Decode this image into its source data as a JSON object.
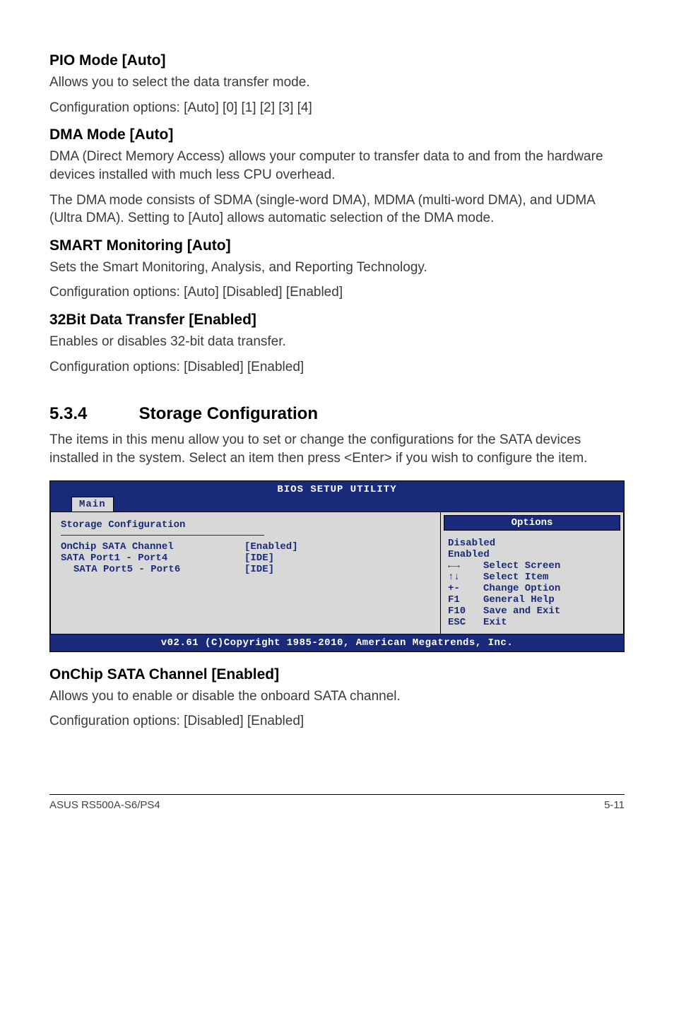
{
  "sections": {
    "pio": {
      "heading": "PIO Mode [Auto]",
      "p1": "Allows you to select the data transfer mode.",
      "p2": "Configuration options: [Auto] [0] [1] [2] [3] [4]"
    },
    "dma": {
      "heading": "DMA Mode [Auto]",
      "p1": "DMA (Direct Memory Access) allows your computer to transfer data to and from the hardware devices installed with much less CPU overhead.",
      "p2": "The DMA mode consists of SDMA (single-word DMA), MDMA (multi-word DMA), and UDMA (Ultra DMA). Setting to [Auto] allows automatic selection of the DMA mode."
    },
    "smart": {
      "heading": "SMART Monitoring [Auto]",
      "p1": "Sets the Smart Monitoring, Analysis, and Reporting Technology.",
      "p2": "Configuration options: [Auto] [Disabled] [Enabled]"
    },
    "bit32": {
      "heading": "32Bit Data Transfer [Enabled]",
      "p1": "Enables or disables 32-bit data transfer.",
      "p2": "Configuration options: [Disabled] [Enabled]"
    },
    "storage": {
      "num": "5.3.4",
      "title": "Storage Configuration",
      "p1": "The items in this menu allow you to set or change the configurations for the SATA devices installed in the system. Select an item then press <Enter> if you wish to configure the item."
    },
    "onchip": {
      "heading": "OnChip SATA Channel [Enabled]",
      "p1": "Allows you to enable or disable the onboard SATA channel.",
      "p2": "Configuration options: [Disabled] [Enabled]"
    }
  },
  "bios": {
    "title": "BIOS SETUP UTILITY",
    "tab": "Main",
    "left_heading": "Storage Configuration",
    "rows": [
      {
        "label": "OnChip SATA Channel",
        "value": "[Enabled]",
        "indent": false
      },
      {
        "label": "SATA Port1 - Port4",
        "value": "[IDE]",
        "indent": false
      },
      {
        "label": "SATA Port5 - Port6",
        "value": "[IDE]",
        "indent": true
      }
    ],
    "options_header": "Options",
    "options": [
      "Disabled",
      "Enabled"
    ],
    "help": [
      {
        "key": "←→",
        "text": "Select Screen"
      },
      {
        "key": "↑↓",
        "text": "Select Item"
      },
      {
        "key": "+-",
        "text": "Change Option"
      },
      {
        "key": "F1",
        "text": "General Help"
      },
      {
        "key": "F10",
        "text": "Save and Exit"
      },
      {
        "key": "ESC",
        "text": "Exit"
      }
    ],
    "footer": "v02.61 (C)Copyright 1985-2010, American Megatrends, Inc."
  },
  "footer": {
    "left": "ASUS RS500A-S6/PS4",
    "right": "5-11"
  }
}
